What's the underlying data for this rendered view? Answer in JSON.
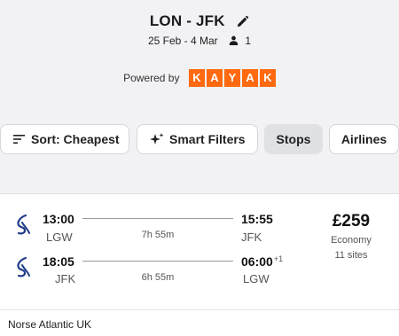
{
  "search": {
    "route": "LON - JFK",
    "dates": "25 Feb - 4 Mar",
    "travellers": "1"
  },
  "powered": {
    "label": "Powered by",
    "brand_letters": [
      "K",
      "A",
      "Y",
      "A",
      "K"
    ],
    "brand_color": "#ff690f"
  },
  "filters": {
    "sort_label": "Sort: Cheapest",
    "smart_label": "Smart Filters",
    "stops_label": "Stops",
    "airlines_label": "Airlines"
  },
  "result": {
    "outbound": {
      "depart_time": "13:00",
      "depart_code": "LGW",
      "duration": "7h 55m",
      "arrive_time": "15:55",
      "arrive_code": "JFK"
    },
    "inbound": {
      "depart_time": "18:05",
      "depart_code": "JFK",
      "duration": "6h 55m",
      "arrive_time": "06:00",
      "arrive_offset": "+1",
      "arrive_code": "LGW"
    },
    "price": "£259",
    "cabin": "Economy",
    "sites": "11 sites",
    "airline": "Norse Atlantic UK"
  }
}
